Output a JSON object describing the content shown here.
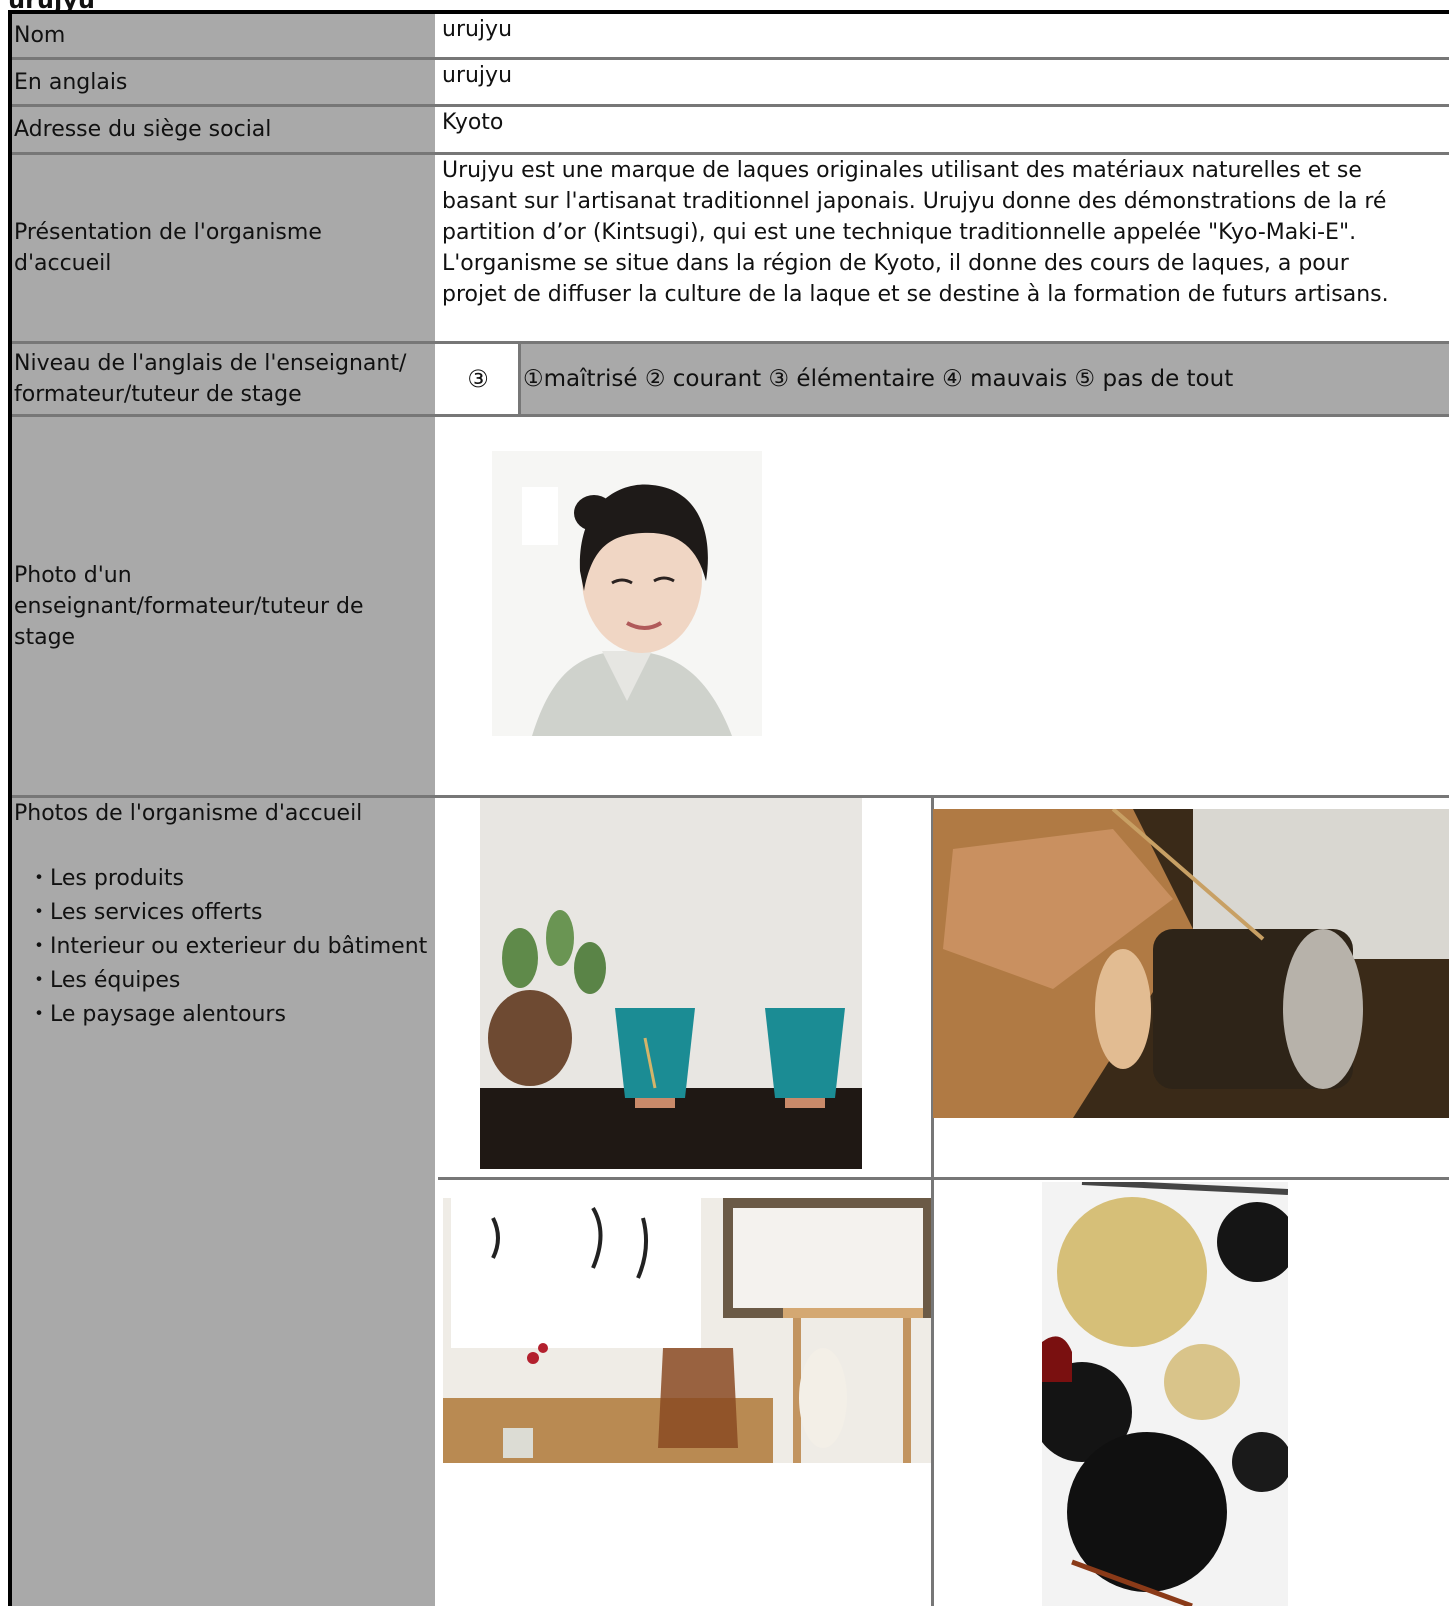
{
  "header": {
    "title": "urujyu"
  },
  "rows": {
    "nom": {
      "label": "Nom",
      "value": "urujyu"
    },
    "anglais": {
      "label": "En anglais",
      "value": "urujyu"
    },
    "adresse": {
      "label": "Adresse du siège social",
      "value": "Kyoto"
    },
    "presentation": {
      "label": "Présentation de l'organisme d'accueil",
      "value": "Urujyu est une marque de laques originales utilisant des matériaux naturelles et se\nbasant sur l'artisanat traditionnel japonais. Urujyu donne des démonstrations de la ré\npartition d’or (Kintsugi), qui est une technique traditionnelle appelée \"Kyo-Maki-E\".\nL'organisme se situe dans la région de Kyoto, il donne des cours de laques, a pour\nprojet de diffuser la culture de la laque et se destine à la formation de futurs artisans."
    },
    "niveau": {
      "label": "Niveau de l'anglais de l'enseignant/ formateur/tuteur de stage",
      "selected": "③",
      "scale": "①maîtrisé  ② courant  ③ élémentaire  ④ mauvais ⑤ pas de tout"
    },
    "photo_enseignant": {
      "label": "Photo d'un enseignant/formateur/tuteur de stage"
    },
    "photos_organisme": {
      "label": "Photos de l'organisme d'accueil",
      "items": [
        "・Les produits",
        "・Les services offerts",
        "・Interieur ou exterieur du bâtiment",
        "・Les équipes",
        "・Le paysage alentours"
      ]
    }
  },
  "colors": {
    "label_bg": "#a9a9a9",
    "border": "#000000",
    "grid": "#777777"
  }
}
